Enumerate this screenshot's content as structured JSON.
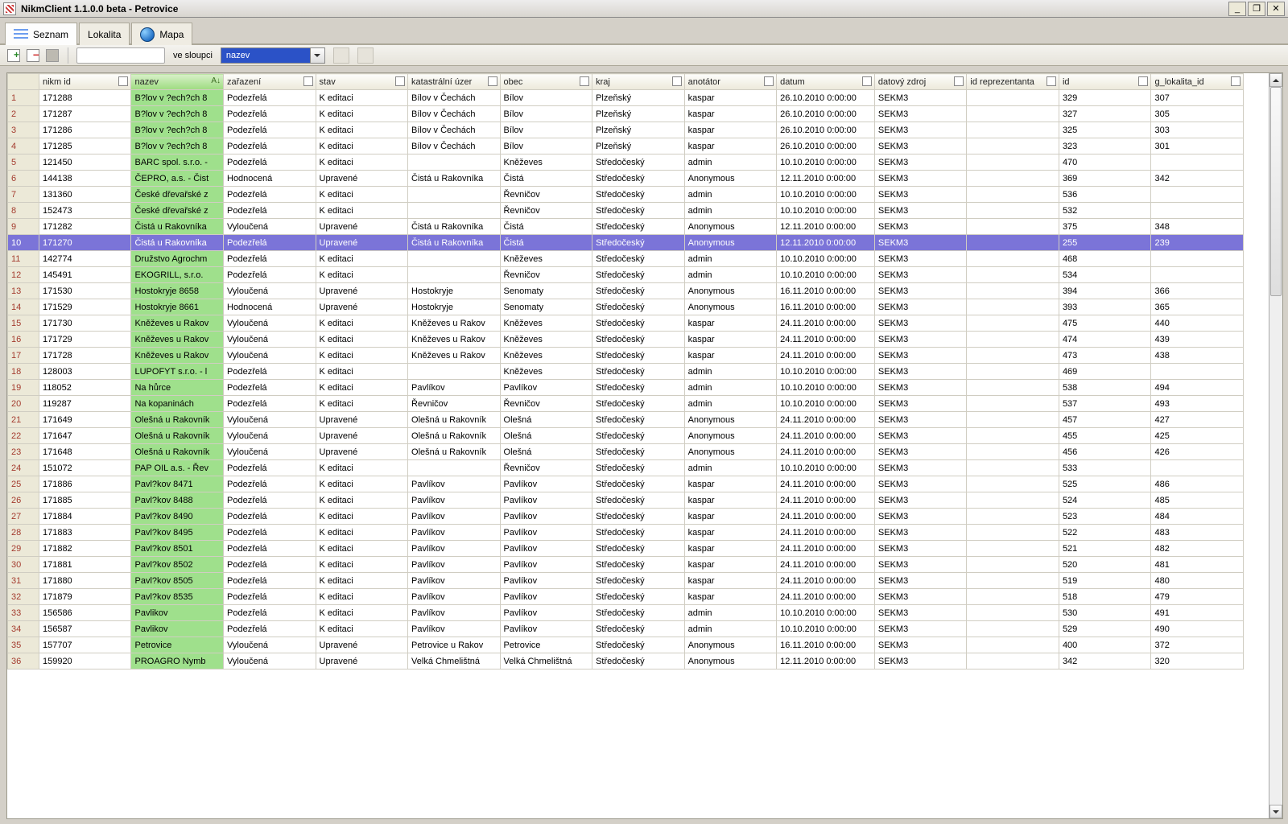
{
  "window": {
    "title": "NikmClient 1.1.0.0 beta - Petrovice"
  },
  "tabs": {
    "seznam": "Seznam",
    "lokalita": "Lokalita",
    "mapa": "Mapa"
  },
  "toolbar": {
    "ve_sloupci": "ve sloupci",
    "column_value": "nazev"
  },
  "columns": {
    "nikm_id": "nikm id",
    "nazev": "nazev",
    "zarazeni": "zařazení",
    "stav": "stav",
    "katastr": "katastrální úzer",
    "obec": "obec",
    "kraj": "kraj",
    "anotator": "anotátor",
    "datum": "datum",
    "datovy_zdroj": "datový zdroj",
    "id_reprezentanta": "id reprezentanta",
    "id": "id",
    "g_lokalita_id": "g_lokalita_id"
  },
  "selected_row_index": 10,
  "rows": [
    {
      "n": "1",
      "nikm": "171288",
      "nazev": "B?lov v ?ech?ch 8",
      "zar": "Podezřelá",
      "stav": "K editaci",
      "kat": "Bílov v Čechách",
      "obec": "Bílov",
      "kraj": "Plzeňský",
      "anot": "kaspar",
      "datum": "26.10.2010 0:00:00",
      "zdroj": "SEKM3",
      "rep": "",
      "id": "329",
      "glok": "307"
    },
    {
      "n": "2",
      "nikm": "171287",
      "nazev": "B?lov v ?ech?ch 8",
      "zar": "Podezřelá",
      "stav": "K editaci",
      "kat": "Bílov v Čechách",
      "obec": "Bílov",
      "kraj": "Plzeňský",
      "anot": "kaspar",
      "datum": "26.10.2010 0:00:00",
      "zdroj": "SEKM3",
      "rep": "",
      "id": "327",
      "glok": "305"
    },
    {
      "n": "3",
      "nikm": "171286",
      "nazev": "B?lov v ?ech?ch 8",
      "zar": "Podezřelá",
      "stav": "K editaci",
      "kat": "Bílov v Čechách",
      "obec": "Bílov",
      "kraj": "Plzeňský",
      "anot": "kaspar",
      "datum": "26.10.2010 0:00:00",
      "zdroj": "SEKM3",
      "rep": "",
      "id": "325",
      "glok": "303"
    },
    {
      "n": "4",
      "nikm": "171285",
      "nazev": "B?lov v ?ech?ch 8",
      "zar": "Podezřelá",
      "stav": "K editaci",
      "kat": "Bílov v Čechách",
      "obec": "Bílov",
      "kraj": "Plzeňský",
      "anot": "kaspar",
      "datum": "26.10.2010 0:00:00",
      "zdroj": "SEKM3",
      "rep": "",
      "id": "323",
      "glok": "301"
    },
    {
      "n": "5",
      "nikm": "121450",
      "nazev": "BARC spol. s.r.o. -",
      "zar": "Podezřelá",
      "stav": "K editaci",
      "kat": "",
      "obec": "Kněževes",
      "kraj": "Středočeský",
      "anot": "admin",
      "datum": "10.10.2010 0:00:00",
      "zdroj": "SEKM3",
      "rep": "",
      "id": "470",
      "glok": ""
    },
    {
      "n": "6",
      "nikm": "144138",
      "nazev": "ČEPRO, a.s. - Čist",
      "zar": "Hodnocená",
      "stav": "Upravené",
      "kat": "Čistá u Rakovníka",
      "obec": "Čistá",
      "kraj": "Středočeský",
      "anot": "Anonymous",
      "datum": "12.11.2010 0:00:00",
      "zdroj": "SEKM3",
      "rep": "",
      "id": "369",
      "glok": "342"
    },
    {
      "n": "7",
      "nikm": "131360",
      "nazev": "České dřevařské z",
      "zar": "Podezřelá",
      "stav": "K editaci",
      "kat": "",
      "obec": "Řevničov",
      "kraj": "Středočeský",
      "anot": "admin",
      "datum": "10.10.2010 0:00:00",
      "zdroj": "SEKM3",
      "rep": "",
      "id": "536",
      "glok": ""
    },
    {
      "n": "8",
      "nikm": "152473",
      "nazev": "České dřevařské z",
      "zar": "Podezřelá",
      "stav": "K editaci",
      "kat": "",
      "obec": "Řevničov",
      "kraj": "Středočeský",
      "anot": "admin",
      "datum": "10.10.2010 0:00:00",
      "zdroj": "SEKM3",
      "rep": "",
      "id": "532",
      "glok": ""
    },
    {
      "n": "9",
      "nikm": "171282",
      "nazev": "Čistá u Rakovníka",
      "zar": "Vyloučená",
      "stav": "Upravené",
      "kat": "Čistá u Rakovníka",
      "obec": "Čistá",
      "kraj": "Středočeský",
      "anot": "Anonymous",
      "datum": "12.11.2010 0:00:00",
      "zdroj": "SEKM3",
      "rep": "",
      "id": "375",
      "glok": "348"
    },
    {
      "n": "10",
      "nikm": "171270",
      "nazev": "Čistá u Rakovníka",
      "zar": "Podezřelá",
      "stav": "Upravené",
      "kat": "Čistá u Rakovníka",
      "obec": "Čistá",
      "kraj": "Středočeský",
      "anot": "Anonymous",
      "datum": "12.11.2010 0:00:00",
      "zdroj": "SEKM3",
      "rep": "",
      "id": "255",
      "glok": "239"
    },
    {
      "n": "11",
      "nikm": "142774",
      "nazev": "Družstvo Agrochm",
      "zar": "Podezřelá",
      "stav": "K editaci",
      "kat": "",
      "obec": "Kněževes",
      "kraj": "Středočeský",
      "anot": "admin",
      "datum": "10.10.2010 0:00:00",
      "zdroj": "SEKM3",
      "rep": "",
      "id": "468",
      "glok": ""
    },
    {
      "n": "12",
      "nikm": "145491",
      "nazev": "EKOGRILL, s.r.o.",
      "zar": "Podezřelá",
      "stav": "K editaci",
      "kat": "",
      "obec": "Řevničov",
      "kraj": "Středočeský",
      "anot": "admin",
      "datum": "10.10.2010 0:00:00",
      "zdroj": "SEKM3",
      "rep": "",
      "id": "534",
      "glok": ""
    },
    {
      "n": "13",
      "nikm": "171530",
      "nazev": "Hostokryje 8658",
      "zar": "Vyloučená",
      "stav": "Upravené",
      "kat": "Hostokryje",
      "obec": "Senomaty",
      "kraj": "Středočeský",
      "anot": "Anonymous",
      "datum": "16.11.2010 0:00:00",
      "zdroj": "SEKM3",
      "rep": "",
      "id": "394",
      "glok": "366"
    },
    {
      "n": "14",
      "nikm": "171529",
      "nazev": "Hostokryje 8661",
      "zar": "Hodnocená",
      "stav": "Upravené",
      "kat": "Hostokryje",
      "obec": "Senomaty",
      "kraj": "Středočeský",
      "anot": "Anonymous",
      "datum": "16.11.2010 0:00:00",
      "zdroj": "SEKM3",
      "rep": "",
      "id": "393",
      "glok": "365"
    },
    {
      "n": "15",
      "nikm": "171730",
      "nazev": "Kněževes u Rakov",
      "zar": "Vyloučená",
      "stav": "K editaci",
      "kat": "Kněževes u Rakov",
      "obec": "Kněževes",
      "kraj": "Středočeský",
      "anot": "kaspar",
      "datum": "24.11.2010 0:00:00",
      "zdroj": "SEKM3",
      "rep": "",
      "id": "475",
      "glok": "440"
    },
    {
      "n": "16",
      "nikm": "171729",
      "nazev": "Kněževes u Rakov",
      "zar": "Vyloučená",
      "stav": "K editaci",
      "kat": "Kněževes u Rakov",
      "obec": "Kněževes",
      "kraj": "Středočeský",
      "anot": "kaspar",
      "datum": "24.11.2010 0:00:00",
      "zdroj": "SEKM3",
      "rep": "",
      "id": "474",
      "glok": "439"
    },
    {
      "n": "17",
      "nikm": "171728",
      "nazev": "Kněževes u Rakov",
      "zar": "Vyloučená",
      "stav": "K editaci",
      "kat": "Kněževes u Rakov",
      "obec": "Kněževes",
      "kraj": "Středočeský",
      "anot": "kaspar",
      "datum": "24.11.2010 0:00:00",
      "zdroj": "SEKM3",
      "rep": "",
      "id": "473",
      "glok": "438"
    },
    {
      "n": "18",
      "nikm": "128003",
      "nazev": "LUPOFYT s.r.o. - l",
      "zar": "Podezřelá",
      "stav": "K editaci",
      "kat": "",
      "obec": "Kněževes",
      "kraj": "Středočeský",
      "anot": "admin",
      "datum": "10.10.2010 0:00:00",
      "zdroj": "SEKM3",
      "rep": "",
      "id": "469",
      "glok": ""
    },
    {
      "n": "19",
      "nikm": "118052",
      "nazev": "Na hůrce",
      "zar": "Podezřelá",
      "stav": "K editaci",
      "kat": "Pavlíkov",
      "obec": "Pavlíkov",
      "kraj": "Středočeský",
      "anot": "admin",
      "datum": "10.10.2010 0:00:00",
      "zdroj": "SEKM3",
      "rep": "",
      "id": "538",
      "glok": "494"
    },
    {
      "n": "20",
      "nikm": "119287",
      "nazev": "Na kopaninách",
      "zar": "Podezřelá",
      "stav": "K editaci",
      "kat": "Řevničov",
      "obec": "Řevničov",
      "kraj": "Středočeský",
      "anot": "admin",
      "datum": "10.10.2010 0:00:00",
      "zdroj": "SEKM3",
      "rep": "",
      "id": "537",
      "glok": "493"
    },
    {
      "n": "21",
      "nikm": "171649",
      "nazev": "Olešná u Rakovník",
      "zar": "Vyloučená",
      "stav": "Upravené",
      "kat": "Olešná u Rakovník",
      "obec": "Olešná",
      "kraj": "Středočeský",
      "anot": "Anonymous",
      "datum": "24.11.2010 0:00:00",
      "zdroj": "SEKM3",
      "rep": "",
      "id": "457",
      "glok": "427"
    },
    {
      "n": "22",
      "nikm": "171647",
      "nazev": "Olešná u Rakovník",
      "zar": "Vyloučená",
      "stav": "Upravené",
      "kat": "Olešná u Rakovník",
      "obec": "Olešná",
      "kraj": "Středočeský",
      "anot": "Anonymous",
      "datum": "24.11.2010 0:00:00",
      "zdroj": "SEKM3",
      "rep": "",
      "id": "455",
      "glok": "425"
    },
    {
      "n": "23",
      "nikm": "171648",
      "nazev": "Olešná u Rakovník",
      "zar": "Vyloučená",
      "stav": "Upravené",
      "kat": "Olešná u Rakovník",
      "obec": "Olešná",
      "kraj": "Středočeský",
      "anot": "Anonymous",
      "datum": "24.11.2010 0:00:00",
      "zdroj": "SEKM3",
      "rep": "",
      "id": "456",
      "glok": "426"
    },
    {
      "n": "24",
      "nikm": "151072",
      "nazev": "PAP OIL a.s. - Řev",
      "zar": "Podezřelá",
      "stav": "K editaci",
      "kat": "",
      "obec": "Řevničov",
      "kraj": "Středočeský",
      "anot": "admin",
      "datum": "10.10.2010 0:00:00",
      "zdroj": "SEKM3",
      "rep": "",
      "id": "533",
      "glok": ""
    },
    {
      "n": "25",
      "nikm": "171886",
      "nazev": "Pavl?kov 8471",
      "zar": "Podezřelá",
      "stav": "K editaci",
      "kat": "Pavlíkov",
      "obec": "Pavlíkov",
      "kraj": "Středočeský",
      "anot": "kaspar",
      "datum": "24.11.2010 0:00:00",
      "zdroj": "SEKM3",
      "rep": "",
      "id": "525",
      "glok": "486"
    },
    {
      "n": "26",
      "nikm": "171885",
      "nazev": "Pavl?kov 8488",
      "zar": "Podezřelá",
      "stav": "K editaci",
      "kat": "Pavlíkov",
      "obec": "Pavlíkov",
      "kraj": "Středočeský",
      "anot": "kaspar",
      "datum": "24.11.2010 0:00:00",
      "zdroj": "SEKM3",
      "rep": "",
      "id": "524",
      "glok": "485"
    },
    {
      "n": "27",
      "nikm": "171884",
      "nazev": "Pavl?kov 8490",
      "zar": "Podezřelá",
      "stav": "K editaci",
      "kat": "Pavlíkov",
      "obec": "Pavlíkov",
      "kraj": "Středočeský",
      "anot": "kaspar",
      "datum": "24.11.2010 0:00:00",
      "zdroj": "SEKM3",
      "rep": "",
      "id": "523",
      "glok": "484"
    },
    {
      "n": "28",
      "nikm": "171883",
      "nazev": "Pavl?kov 8495",
      "zar": "Podezřelá",
      "stav": "K editaci",
      "kat": "Pavlíkov",
      "obec": "Pavlíkov",
      "kraj": "Středočeský",
      "anot": "kaspar",
      "datum": "24.11.2010 0:00:00",
      "zdroj": "SEKM3",
      "rep": "",
      "id": "522",
      "glok": "483"
    },
    {
      "n": "29",
      "nikm": "171882",
      "nazev": "Pavl?kov 8501",
      "zar": "Podezřelá",
      "stav": "K editaci",
      "kat": "Pavlíkov",
      "obec": "Pavlíkov",
      "kraj": "Středočeský",
      "anot": "kaspar",
      "datum": "24.11.2010 0:00:00",
      "zdroj": "SEKM3",
      "rep": "",
      "id": "521",
      "glok": "482"
    },
    {
      "n": "30",
      "nikm": "171881",
      "nazev": "Pavl?kov 8502",
      "zar": "Podezřelá",
      "stav": "K editaci",
      "kat": "Pavlíkov",
      "obec": "Pavlíkov",
      "kraj": "Středočeský",
      "anot": "kaspar",
      "datum": "24.11.2010 0:00:00",
      "zdroj": "SEKM3",
      "rep": "",
      "id": "520",
      "glok": "481"
    },
    {
      "n": "31",
      "nikm": "171880",
      "nazev": "Pavl?kov 8505",
      "zar": "Podezřelá",
      "stav": "K editaci",
      "kat": "Pavlíkov",
      "obec": "Pavlíkov",
      "kraj": "Středočeský",
      "anot": "kaspar",
      "datum": "24.11.2010 0:00:00",
      "zdroj": "SEKM3",
      "rep": "",
      "id": "519",
      "glok": "480"
    },
    {
      "n": "32",
      "nikm": "171879",
      "nazev": "Pavl?kov 8535",
      "zar": "Podezřelá",
      "stav": "K editaci",
      "kat": "Pavlíkov",
      "obec": "Pavlíkov",
      "kraj": "Středočeský",
      "anot": "kaspar",
      "datum": "24.11.2010 0:00:00",
      "zdroj": "SEKM3",
      "rep": "",
      "id": "518",
      "glok": "479"
    },
    {
      "n": "33",
      "nikm": "156586",
      "nazev": "Pavlikov",
      "zar": "Podezřelá",
      "stav": "K editaci",
      "kat": "Pavlíkov",
      "obec": "Pavlíkov",
      "kraj": "Středočeský",
      "anot": "admin",
      "datum": "10.10.2010 0:00:00",
      "zdroj": "SEKM3",
      "rep": "",
      "id": "530",
      "glok": "491"
    },
    {
      "n": "34",
      "nikm": "156587",
      "nazev": "Pavlikov",
      "zar": "Podezřelá",
      "stav": "K editaci",
      "kat": "Pavlíkov",
      "obec": "Pavlíkov",
      "kraj": "Středočeský",
      "anot": "admin",
      "datum": "10.10.2010 0:00:00",
      "zdroj": "SEKM3",
      "rep": "",
      "id": "529",
      "glok": "490"
    },
    {
      "n": "35",
      "nikm": "157707",
      "nazev": "Petrovice",
      "zar": "Vyloučená",
      "stav": "Upravené",
      "kat": "Petrovice u Rakov",
      "obec": "Petrovice",
      "kraj": "Středočeský",
      "anot": "Anonymous",
      "datum": "16.11.2010 0:00:00",
      "zdroj": "SEKM3",
      "rep": "",
      "id": "400",
      "glok": "372"
    },
    {
      "n": "36",
      "nikm": "159920",
      "nazev": "PROAGRO Nymb",
      "zar": "Vyloučená",
      "stav": "Upravené",
      "kat": "Velká Chmelištná",
      "obec": "Velká Chmelištná",
      "kraj": "Středočeský",
      "anot": "Anonymous",
      "datum": "12.11.2010 0:00:00",
      "zdroj": "SEKM3",
      "rep": "",
      "id": "342",
      "glok": "320"
    }
  ]
}
